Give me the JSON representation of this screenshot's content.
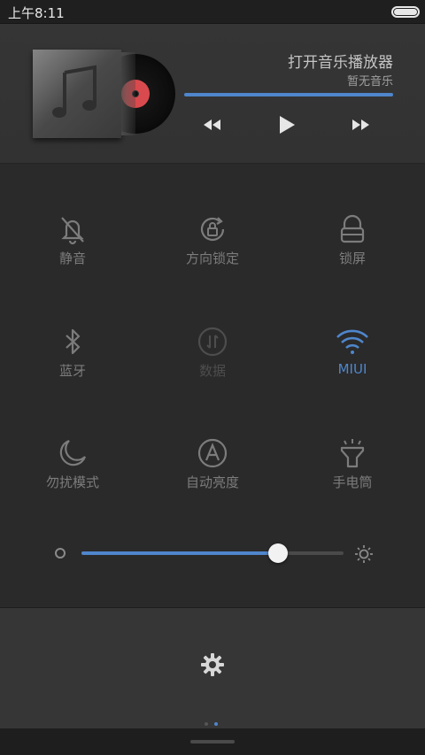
{
  "status_bar": {
    "time": "上午8:11"
  },
  "music": {
    "title": "打开音乐播放器",
    "subtitle": "暂无音乐",
    "controls": [
      "previous-icon",
      "play-icon",
      "next-icon"
    ]
  },
  "toggles": [
    {
      "id": "mute",
      "label": "静音",
      "icon": "bell-mute-icon",
      "state": "off"
    },
    {
      "id": "rotation-lock",
      "label": "方向锁定",
      "icon": "rotation-lock-icon",
      "state": "off"
    },
    {
      "id": "lock-screen",
      "label": "锁屏",
      "icon": "lock-icon",
      "state": "off"
    },
    {
      "id": "bluetooth",
      "label": "蓝牙",
      "icon": "bluetooth-icon",
      "state": "off"
    },
    {
      "id": "data",
      "label": "数据",
      "icon": "data-icon",
      "state": "disabled"
    },
    {
      "id": "wifi",
      "label": "MIUI",
      "icon": "wifi-icon",
      "state": "on"
    },
    {
      "id": "dnd",
      "label": "勿扰模式",
      "icon": "moon-icon",
      "state": "off"
    },
    {
      "id": "auto-brightness",
      "label": "自动亮度",
      "icon": "auto-brightness-icon",
      "state": "off"
    },
    {
      "id": "flashlight",
      "label": "手电筒",
      "icon": "flashlight-icon",
      "state": "off"
    }
  ],
  "brightness": {
    "level": 0.75
  },
  "pager": {
    "pages": 2,
    "current": 1
  },
  "colors": {
    "accent": "#4f86cc",
    "record_label": "#d94a4e"
  }
}
